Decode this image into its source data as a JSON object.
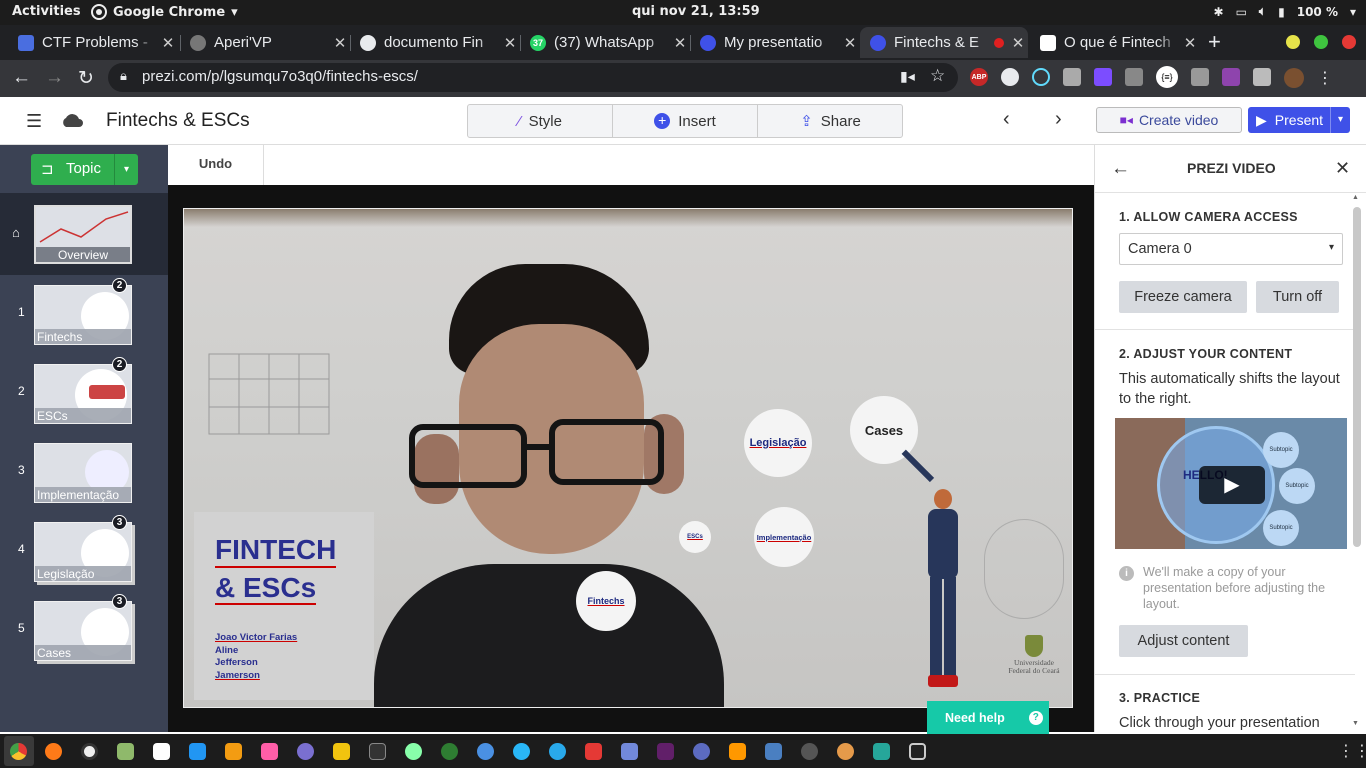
{
  "system_bar": {
    "activities": "Activities",
    "app_name": "Google Chrome",
    "clock": "qui nov 21, 13:59",
    "battery": "100 %"
  },
  "tabs": [
    {
      "title": "CTF Problems -",
      "color": "#4a6ee0",
      "favicon": "ctf-icon"
    },
    {
      "title": "Aperi'VP",
      "color": "#666",
      "favicon": "hexagon-icon"
    },
    {
      "title": "documento Fin",
      "color": "#e8eaed",
      "favicon": "globe-icon"
    },
    {
      "title": "(37) WhatsApp",
      "color": "#25d366",
      "favicon": "whatsapp-icon"
    },
    {
      "title": "My presentatio",
      "color": "#3f51e8",
      "favicon": "prezi-icon"
    },
    {
      "title": "Fintechs & E",
      "color": "#3f51e8",
      "favicon": "prezi-icon"
    },
    {
      "title": "O que é Fintech",
      "color": "#fff",
      "favicon": "page-icon"
    }
  ],
  "address": {
    "url": "prezi.com/p/lgsumqu7o3q0/fintechs-escs/"
  },
  "prezi": {
    "title": "Fintechs & ESCs",
    "style": "Style",
    "insert": "Insert",
    "share": "Share",
    "create_video": "Create video",
    "present": "Present",
    "topic": "Topic",
    "undo": "Undo"
  },
  "sidebar": {
    "overview": "Overview",
    "items": [
      {
        "num": "1",
        "label": "Fintechs",
        "badge": "2"
      },
      {
        "num": "2",
        "label": "ESCs",
        "badge": "2"
      },
      {
        "num": "3",
        "label": "Implementação",
        "badge": ""
      },
      {
        "num": "4",
        "label": "Legislação",
        "badge": "3"
      },
      {
        "num": "5",
        "label": "Cases",
        "badge": "3"
      }
    ]
  },
  "slide": {
    "title_line1": "FINTECH",
    "title_line2": "& ESCs",
    "authors": [
      "Joao Victor Farias",
      "Aline",
      "Jefferson",
      "Jamerson"
    ],
    "bubbles": {
      "legislacao": "Legislação",
      "cases": "Cases",
      "escs": "ESCs",
      "implementacao": "Implementação",
      "fintechs": "Fintechs"
    },
    "university": "Universidade Federal do Ceará"
  },
  "panel": {
    "title": "PREZI VIDEO",
    "s1": "1. ALLOW CAMERA ACCESS",
    "camera": "Camera 0",
    "freeze": "Freeze camera",
    "turnoff": "Turn off",
    "s2": "2. ADJUST YOUR CONTENT",
    "s2_text": "This automatically shifts the layout to the right.",
    "video_subtopic": "Subtopic",
    "video_hello": "HELLO!",
    "note": "We'll make a copy of your presentation before adjusting the layout.",
    "adjust": "Adjust content",
    "s3": "3. PRACTICE",
    "s3_text": "Click through your presentation"
  },
  "help": "Need help"
}
